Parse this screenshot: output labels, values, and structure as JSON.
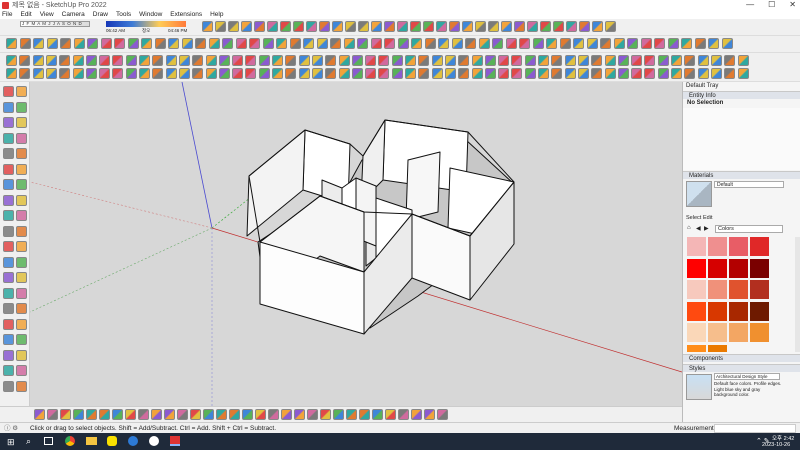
{
  "window": {
    "title": "제목 없음 - SketchUp Pro 2022",
    "min": "—",
    "max": "☐",
    "close": "✕"
  },
  "menu": [
    "File",
    "Edit",
    "View",
    "Camera",
    "Draw",
    "Tools",
    "Window",
    "Extensions",
    "Help"
  ],
  "shadow": {
    "time_left": "06:42 AM",
    "time_mid": "정오",
    "time_right": "04:46 PM",
    "months": "J F M A M J J A S O N D"
  },
  "tray": {
    "title": "Default Tray",
    "entity_info": {
      "header": "Entity Info",
      "value": "No Selection"
    },
    "materials": {
      "header": "Materials",
      "current": "Default",
      "tabs": [
        "Select",
        "Edit"
      ],
      "library": "Colors"
    },
    "components": {
      "header": "Components"
    },
    "styles": {
      "header": "Styles",
      "name": "Architectural Design Style",
      "description": "Default face colors. Profile edges. Light blue sky and gray background color."
    }
  },
  "status": {
    "hint": "Click or drag to select objects. Shift = Add/Subtract. Ctrl = Add. Shift + Ctrl = Subtract.",
    "measurements_label": "Measurements"
  },
  "taskbar": {
    "time": "오후 2:42",
    "date": "2023-10-26"
  },
  "colors": {
    "swatches": [
      "#f4b6b6",
      "#ef8f8f",
      "#e85d66",
      "#e02828",
      "#ff0000",
      "#d60000",
      "#b30000",
      "#7a0000",
      "#f7c9bd",
      "#f0917a",
      "#e0532e",
      "#b22f1f",
      "#ff4a10",
      "#d83800",
      "#a82800",
      "#6e1a00",
      "#fad7b8",
      "#f6be8c",
      "#f3a663",
      "#f0902f",
      "#ff8d1a",
      "#ea7a00"
    ]
  }
}
